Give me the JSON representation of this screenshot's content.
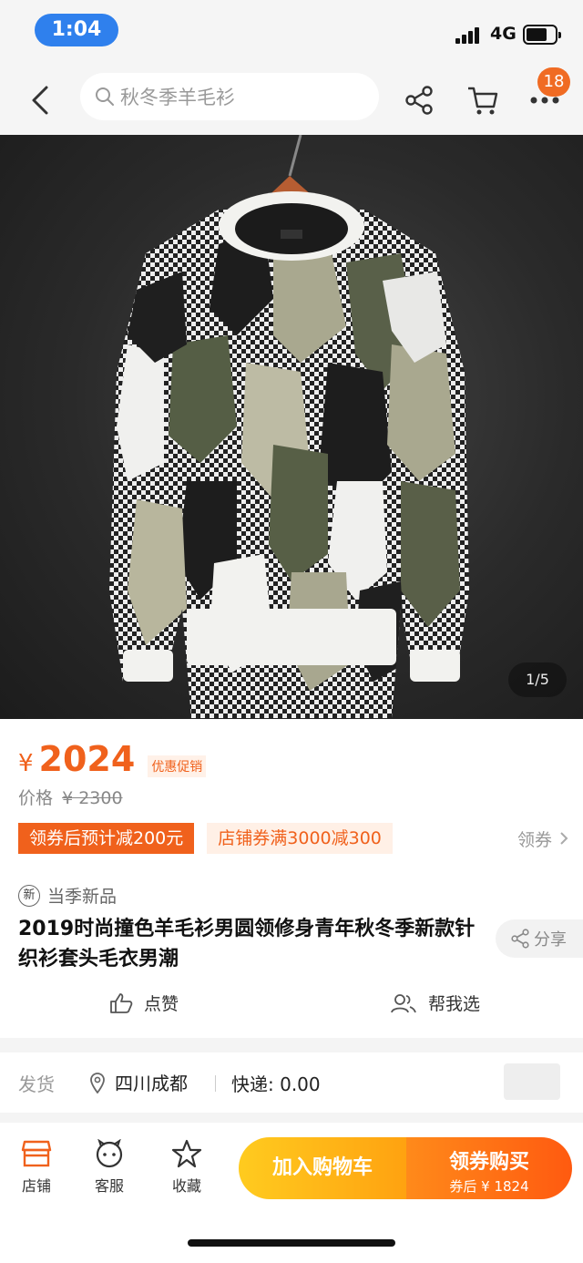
{
  "status_bar": {
    "time": "1:04",
    "network": "4G"
  },
  "nav": {
    "search_placeholder": "秋冬季羊毛衫",
    "badge_count": "18"
  },
  "gallery": {
    "counter": "1/5"
  },
  "price": {
    "currency": "¥",
    "amount": "2024",
    "promo_label": "优惠促销",
    "original_label": "价格",
    "original_price": "¥ 2300"
  },
  "coupons": {
    "coupon1": "领券后预计减200元",
    "coupon2": "店铺券满3000减300",
    "more_label": "领券"
  },
  "product": {
    "new_icon": "新",
    "new_label": "当季新品",
    "title": "2019时尚撞色羊毛衫男圆领修身青年秋冬季新款针织衫套头毛衣男潮",
    "share_label": "分享",
    "like_label": "点赞",
    "help_choose_label": "帮我选"
  },
  "delivery": {
    "label": "发货",
    "location": "四川成都",
    "shipping": "快递: 0.00"
  },
  "bottom_bar": {
    "shop_label": "店铺",
    "service_label": "客服",
    "favorite_label": "收藏",
    "add_cart_label": "加入购物车",
    "buy_label": "领券购买",
    "buy_sub": "券后 ¥ 1824"
  },
  "colors": {
    "accent": "#f0611c",
    "cart_button": "#ffb515",
    "buy_button": "#ff6a12",
    "time_pill": "#2f80ed"
  }
}
